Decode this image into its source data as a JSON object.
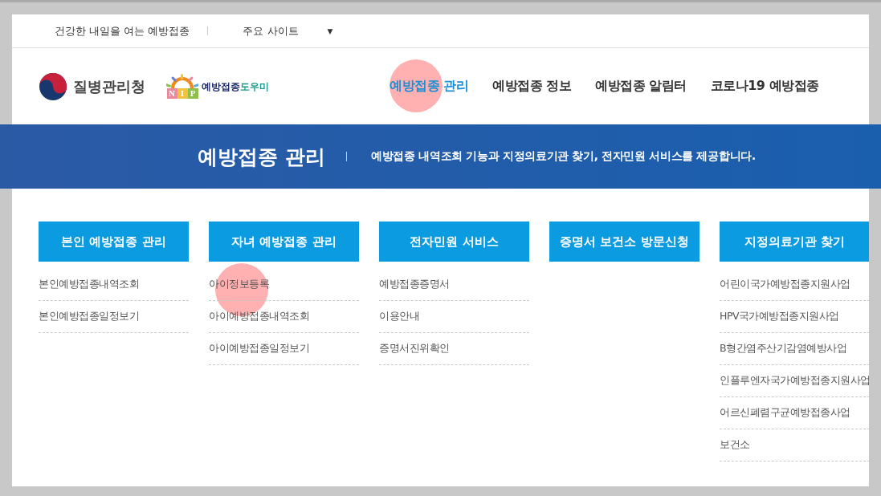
{
  "top_bar": {
    "slogan": "건강한 내일을 여는 예방접종",
    "site_select": {
      "label": "주요 사이트",
      "caret": "▼"
    }
  },
  "header": {
    "agency_name": "질병관리청",
    "nip_logo": {
      "letters": [
        "N",
        "I",
        "P"
      ],
      "wordmark_main": "예방접종",
      "wordmark_accent": "도우미"
    },
    "nav": [
      {
        "label": "예방접종 관리",
        "selected": true,
        "highlighted": true
      },
      {
        "label": "예방접종 정보",
        "selected": false,
        "highlighted": false
      },
      {
        "label": "예방접종 알림터",
        "selected": false,
        "highlighted": false
      },
      {
        "label": "코로나19 예방접종",
        "selected": false,
        "highlighted": false
      }
    ]
  },
  "banner": {
    "title": "예방접종 관리",
    "description": "예방접종 내역조회 기능과 지정의료기관 찾기, 전자민원 서비스를 제공합니다."
  },
  "menu_columns": [
    {
      "heading": "본인 예방접종 관리",
      "items": [
        {
          "label": "본인예방접종내역조회",
          "highlighted": false
        },
        {
          "label": "본인예방접종일정보기",
          "highlighted": false
        }
      ]
    },
    {
      "heading": "자녀 예방접종 관리",
      "items": [
        {
          "label": "아이정보등록",
          "highlighted": true
        },
        {
          "label": "아이예방접종내역조회",
          "highlighted": false
        },
        {
          "label": "아이예방접종일정보기",
          "highlighted": false
        }
      ]
    },
    {
      "heading": "전자민원 서비스",
      "items": [
        {
          "label": "예방접종증명서",
          "highlighted": false
        },
        {
          "label": "이용안내",
          "highlighted": false
        },
        {
          "label": "증명서진위확인",
          "highlighted": false
        }
      ]
    },
    {
      "heading": "증명서 보건소 방문신청"
    },
    {
      "heading": "지정의료기관 찾기",
      "items": [
        {
          "label": "어린이국가예방접종지원사업",
          "highlighted": false
        },
        {
          "label": "HPV국가예방접종지원사업",
          "highlighted": false
        },
        {
          "label": "B형간염주산기감염예방사업",
          "highlighted": false
        },
        {
          "label": "인플루엔자국가예방접종지원사업",
          "highlighted": false
        },
        {
          "label": "어르신폐렴구균예방접종사업",
          "highlighted": false
        },
        {
          "label": "보건소",
          "highlighted": false
        }
      ]
    }
  ]
}
